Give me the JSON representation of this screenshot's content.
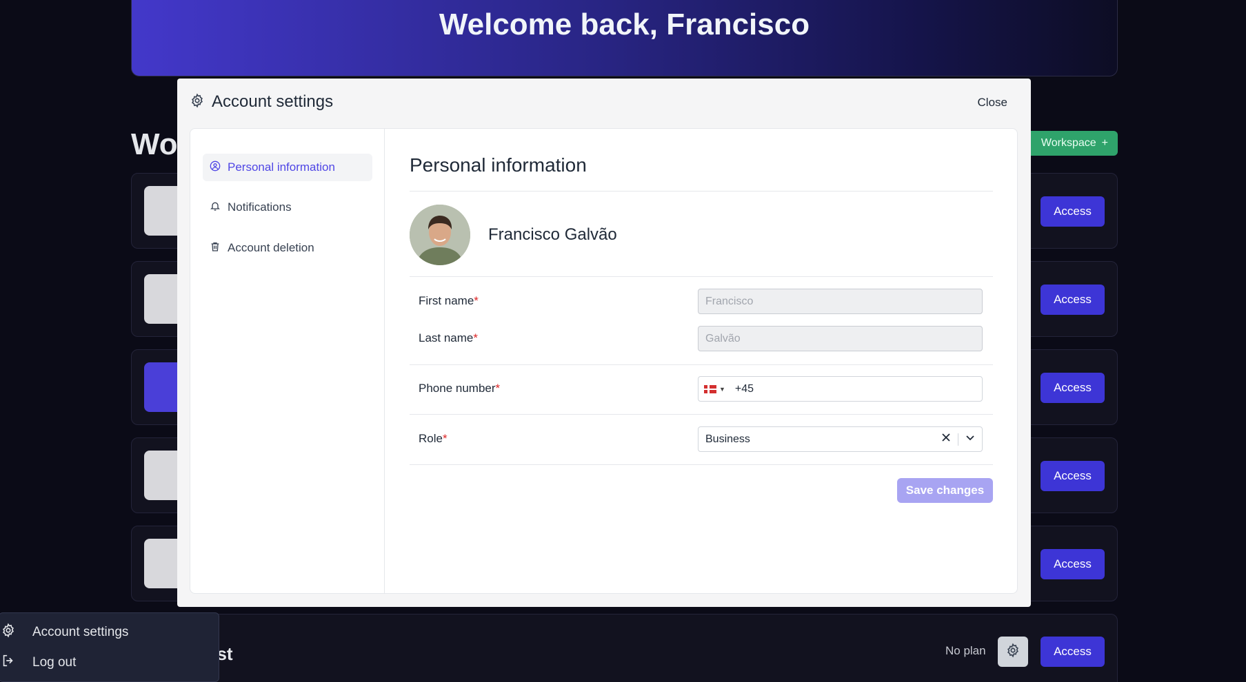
{
  "hero": {
    "title": "Welcome back, Francisco"
  },
  "background": {
    "heading": "Wo",
    "new_workspace": "Workspace",
    "access_label": "Access",
    "last_card_name": "est",
    "last_card_plan": "No plan"
  },
  "modal": {
    "title": "Account settings",
    "close_label": "Close",
    "nav": [
      {
        "label": "Personal information",
        "icon": "user-circle-icon"
      },
      {
        "label": "Notifications",
        "icon": "bell-icon"
      },
      {
        "label": "Account deletion",
        "icon": "trash-icon"
      }
    ],
    "section_title": "Personal information",
    "user_name": "Francisco Galvão",
    "fields": {
      "first_name_label": "First name",
      "first_name_value": "Francisco",
      "last_name_label": "Last name",
      "last_name_value": "Galvão",
      "phone_label": "Phone number",
      "phone_prefix": "+45",
      "role_label": "Role",
      "role_value": "Business"
    },
    "required_mark": "*",
    "save_label": "Save changes"
  },
  "account_menu": {
    "items": [
      {
        "label": "Account settings",
        "icon": "gear-icon"
      },
      {
        "label": "Log out",
        "icon": "logout-icon"
      }
    ]
  },
  "colors": {
    "accent": "#4f46e5",
    "access_button": "#3d35d6",
    "save_disabled": "#a8a4f2",
    "required": "#dc2626"
  }
}
